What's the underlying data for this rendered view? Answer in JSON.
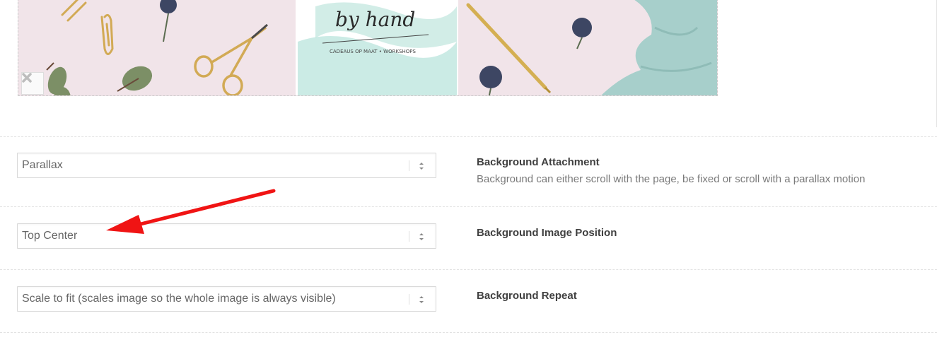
{
  "preview": {
    "book_title": "by hand",
    "book_subtitle": "CADEAUS OP MAAT • WORKSHOPS"
  },
  "settings": [
    {
      "key": "attachment",
      "value": "Parallax",
      "label": "Background Attachment",
      "description": "Background can either scroll with the page, be fixed or scroll with a parallax motion"
    },
    {
      "key": "position",
      "value": "Top Center",
      "label": "Background Image Position",
      "description": ""
    },
    {
      "key": "repeat",
      "value": "Scale to fit (scales image so the whole image is always visible)",
      "label": "Background Repeat",
      "description": ""
    }
  ],
  "colors": {
    "annotation_arrow": "#f01414",
    "label_text": "#404040",
    "description_text": "#7a7a7a"
  }
}
